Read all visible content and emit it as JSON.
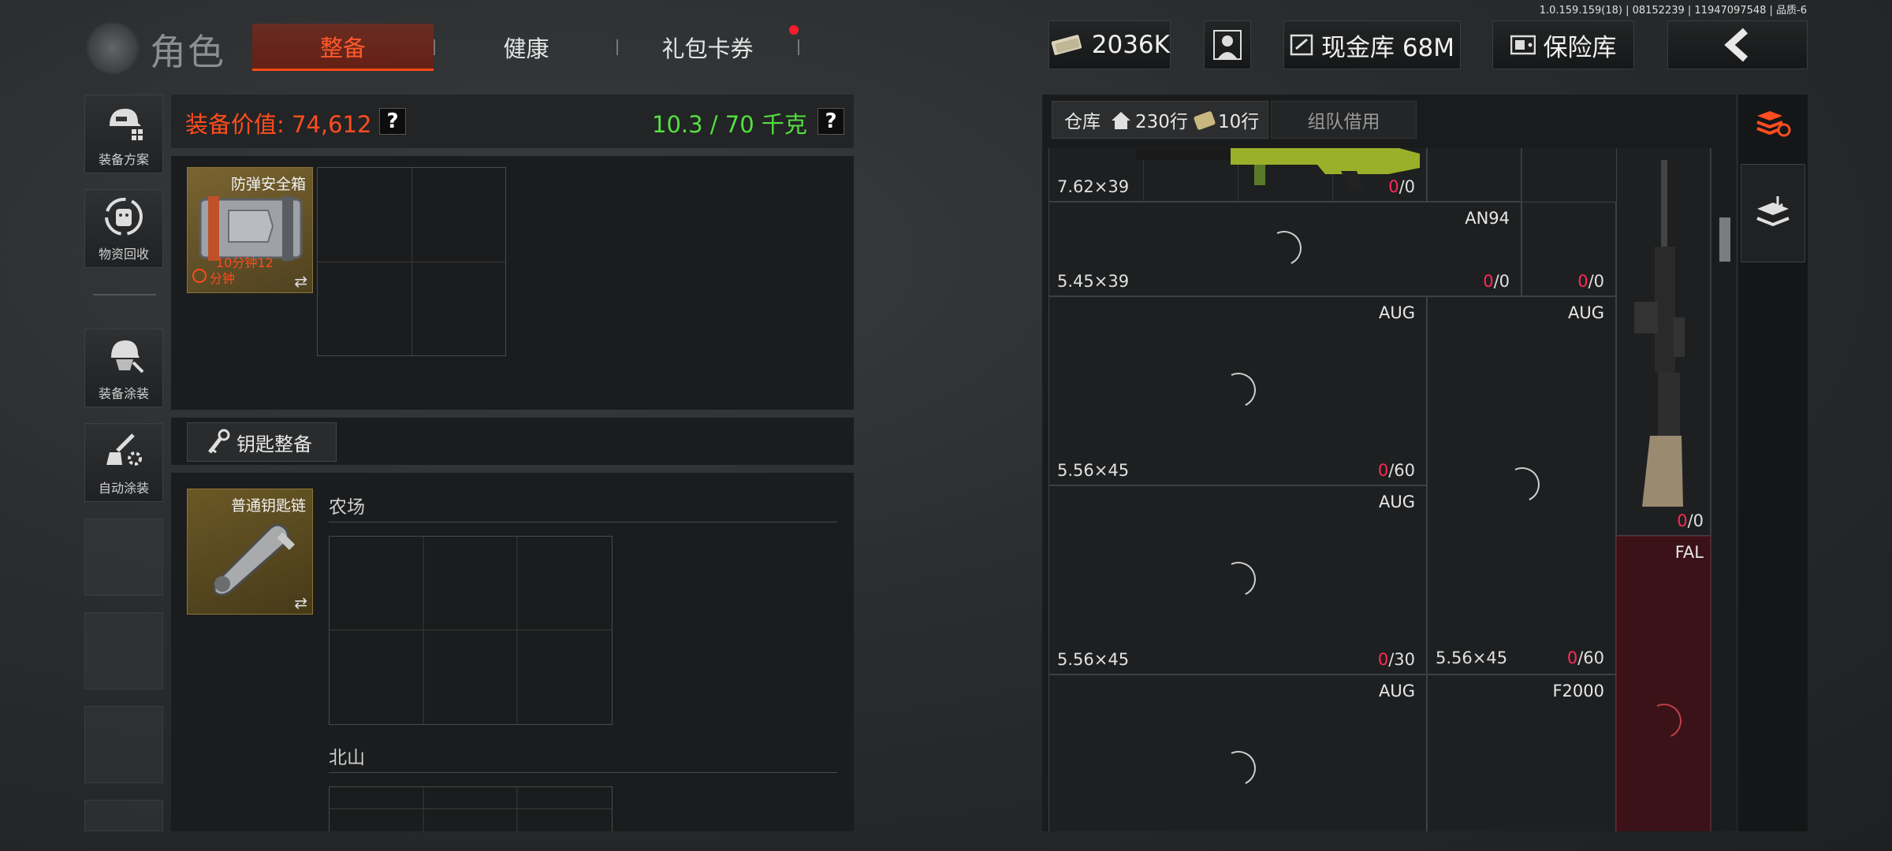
{
  "version_text": "1.0.159.159(18) | 08152239 | 11947097548 | 品质-6",
  "header": {
    "title": "角色",
    "tabs": [
      {
        "label": "整备",
        "active": true
      },
      {
        "label": "健康",
        "active": false
      },
      {
        "label": "礼包卡券",
        "active": false,
        "badge": true
      }
    ],
    "currency": "2036K",
    "cash_vault": "现金库 68M",
    "safe_vault": "保险库"
  },
  "sidebar": {
    "items": [
      {
        "label": "装备方案",
        "icon": "loadout-plan-icon"
      },
      {
        "label": "物资回收",
        "icon": "supply-recycle-icon"
      },
      {
        "label": "装备涂装",
        "icon": "equipment-skin-icon"
      },
      {
        "label": "自动涂装",
        "icon": "auto-paint-icon"
      }
    ]
  },
  "loadout": {
    "value_label": "装备价值: 74,612",
    "weight_label": "10.3 / 70 千克",
    "help": "?",
    "safe_box": {
      "name": "防弹安全箱",
      "timer_text": "10分钟12",
      "timer_unit": "分钟"
    },
    "key_section_button": "钥匙整备",
    "keychain": {
      "name": "普通钥匙链"
    },
    "key_groups": [
      "农场",
      "北山"
    ]
  },
  "warehouse": {
    "tab_label": "仓库",
    "rows_stat": "230行",
    "extra_rows_stat": "10行",
    "team_borrow_label": "组队借用",
    "cells": [
      {
        "id": "c1",
        "caliber": "7.62×39",
        "name": "",
        "zero": "0",
        "total": "/0"
      },
      {
        "id": "c2",
        "caliber": "5.45×39",
        "name": "AN94",
        "zero": "0",
        "total": "/0"
      },
      {
        "id": "c3",
        "caliber": "",
        "name": "",
        "zero": "0",
        "total": "/0"
      },
      {
        "id": "c4",
        "caliber": "5.56×45",
        "name": "AUG",
        "zero": "0",
        "total": "/60"
      },
      {
        "id": "c5",
        "caliber": "",
        "name": "AUG",
        "zero": "",
        "total": ""
      },
      {
        "id": "c6",
        "caliber": "",
        "name": "",
        "zero": "0",
        "total": "/0"
      },
      {
        "id": "c7",
        "caliber": "5.56×45",
        "name": "AUG",
        "zero": "0",
        "total": "/30"
      },
      {
        "id": "c8",
        "caliber": "5.56×45",
        "name": "",
        "zero": "0",
        "total": "/60"
      },
      {
        "id": "c9",
        "caliber": "",
        "name": "FAL",
        "zero": "",
        "total": ""
      },
      {
        "id": "c10",
        "caliber": "",
        "name": "AUG",
        "zero": "",
        "total": ""
      },
      {
        "id": "c11",
        "caliber": "",
        "name": "F2000",
        "zero": "",
        "total": ""
      }
    ]
  },
  "colors": {
    "accent_orange": "#ff4d1f",
    "weight_green": "#52e040",
    "count_red": "#ff2a55",
    "highlight_cell": "#3b1217"
  }
}
